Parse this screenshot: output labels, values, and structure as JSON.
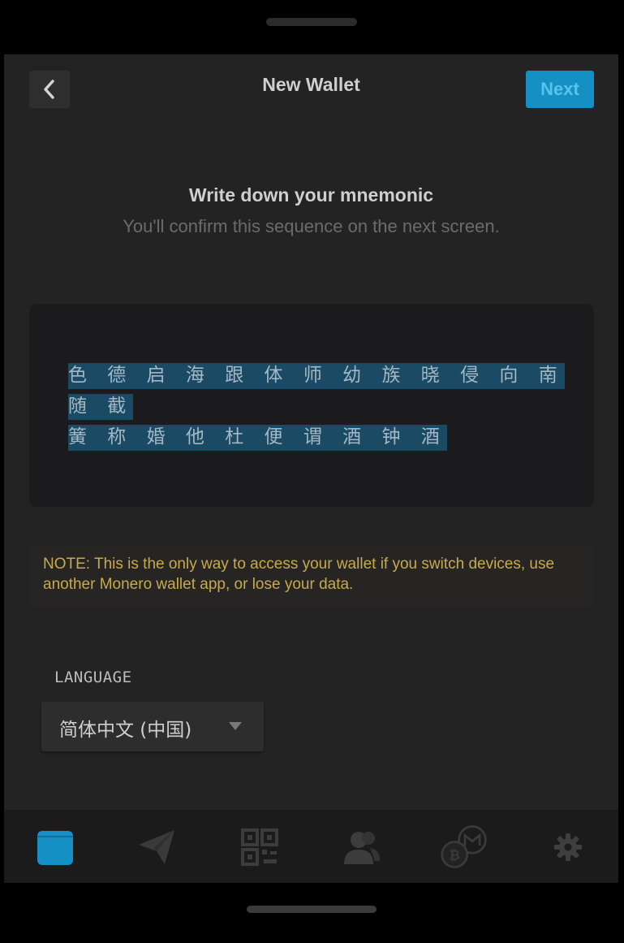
{
  "header": {
    "title": "New Wallet",
    "next_label": "Next",
    "back_icon": "chevron-left-icon"
  },
  "mnemonic_section": {
    "heading": "Write down your mnemonic",
    "subheading": "You'll confirm this sequence on the next screen.",
    "line1": "色 德 启 海 跟 体 师 幼 族 晓 侵 向 南 随 截",
    "line2": "簧 称 婚 他 杜 便 谓 酒 钟 酒"
  },
  "note": {
    "text": "NOTE: This is the only way to access your wallet if you switch devices, use another Monero wallet app, or lose your data."
  },
  "language": {
    "label": "LANGUAGE",
    "selected": "简体中文 (中国)"
  },
  "tab_bar": {
    "active_index": 0,
    "tabs": [
      {
        "icon": "wallet-icon"
      },
      {
        "icon": "send-icon"
      },
      {
        "icon": "qr-code-icon"
      },
      {
        "icon": "contacts-icon"
      },
      {
        "icon": "exchange-icon"
      },
      {
        "icon": "gear-icon"
      }
    ]
  },
  "colors": {
    "accent": "#1490c4",
    "note_text": "#c8aa4b",
    "highlight": "#1a4a64",
    "background": "#232323"
  }
}
